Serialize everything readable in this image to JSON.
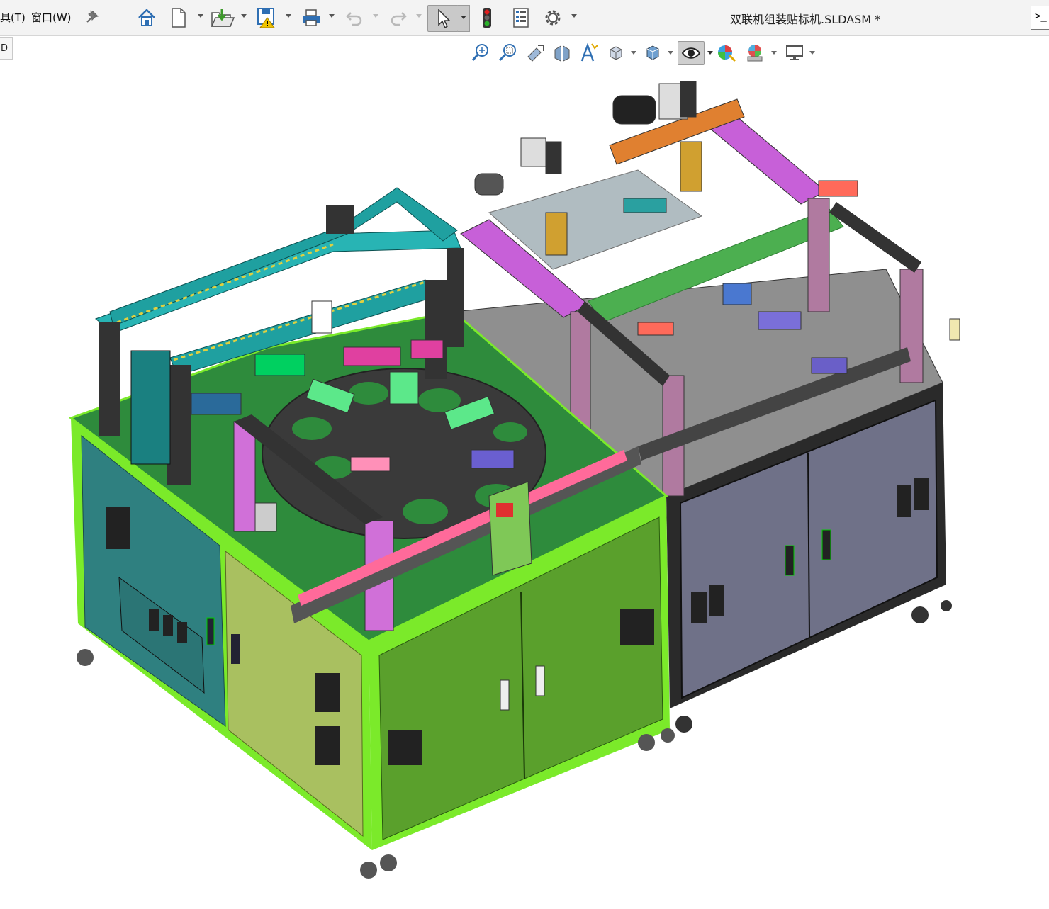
{
  "menu": {
    "tools_label": "具(T)",
    "window_label": "窗口(W)"
  },
  "document": {
    "title": "双联机组装贴标机.SLDASM *"
  },
  "side_tab": {
    "label": "D"
  },
  "terminal": {
    "label": ">_"
  },
  "toolbar": {
    "icons": [
      "home-icon",
      "new-document-icon",
      "open-icon",
      "save-icon",
      "print-icon",
      "undo-icon",
      "redo-icon",
      "select-icon",
      "rebuild-icon",
      "file-properties-icon",
      "options-icon"
    ]
  },
  "view_toolbar": {
    "icons": [
      "zoom-to-fit-icon",
      "zoom-to-area-icon",
      "previous-view-icon",
      "section-view-icon",
      "dynamic-annotation-icon",
      "view-orientation-icon",
      "display-style-icon",
      "hide-show-items-icon",
      "edit-appearance-icon",
      "apply-scene-icon",
      "view-settings-icon"
    ]
  },
  "colors": {
    "accent": "#2f6fb3",
    "cabinet_left_teal": "#2f8080",
    "cabinet_left_olive": "#a9c060",
    "cabinet_front_green": "#5aa02c",
    "cabinet_right_grey": "#6f7188",
    "table_top_green": "#2e8b3c",
    "frame_trim": "#7bea2a"
  }
}
